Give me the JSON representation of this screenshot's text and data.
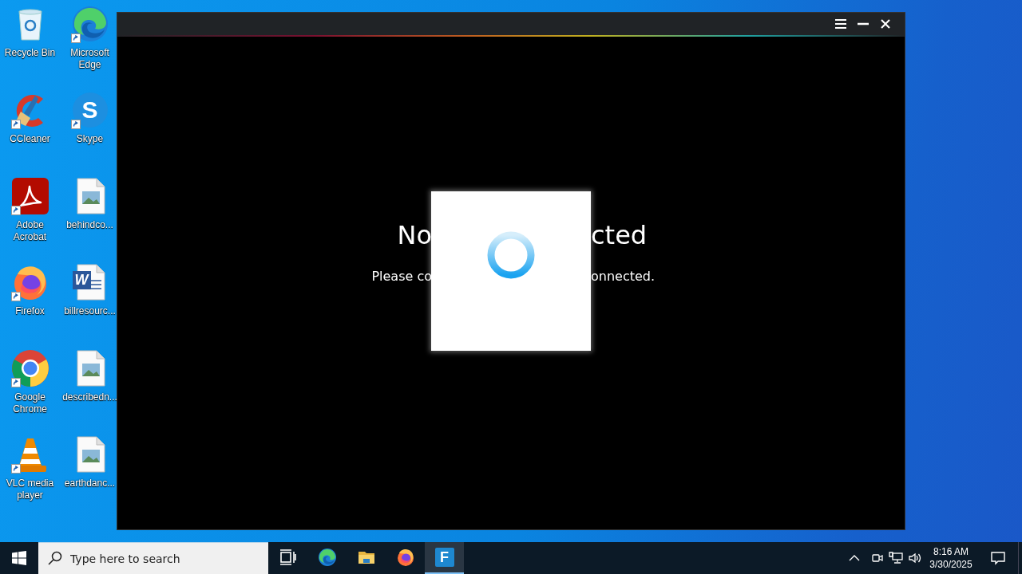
{
  "desktop_icons": [
    {
      "label": "Recycle Bin",
      "kind": "recycle",
      "shortcut": false
    },
    {
      "label": "CCleaner",
      "kind": "ccleaner",
      "shortcut": true
    },
    {
      "label": "Adobe Acrobat",
      "kind": "acrobat",
      "shortcut": true
    },
    {
      "label": "Firefox",
      "kind": "firefox",
      "shortcut": true
    },
    {
      "label": "Google Chrome",
      "kind": "chrome",
      "shortcut": true
    },
    {
      "label": "VLC media player",
      "kind": "vlc",
      "shortcut": true
    },
    {
      "label": "Microsoft Edge",
      "kind": "edge",
      "shortcut": true
    },
    {
      "label": "Skype",
      "kind": "skype",
      "glyph": "S",
      "shortcut": true
    },
    {
      "label": "behindco...",
      "kind": "image",
      "shortcut": false
    },
    {
      "label": "billresourc...",
      "kind": "word",
      "glyph": "W",
      "shortcut": false
    },
    {
      "label": "describedn...",
      "kind": "image",
      "shortcut": false
    },
    {
      "label": "earthdanc...",
      "kind": "image",
      "shortcut": false
    }
  ],
  "window": {
    "title_parts": [
      "No",
      "cted"
    ],
    "message_parts": [
      "Please co",
      "onnected."
    ],
    "dialog": {
      "kind": "loading"
    }
  },
  "taskbar": {
    "search": {
      "placeholder": "Type here to search"
    },
    "apps": [
      {
        "kind": "taskview",
        "selected": false
      },
      {
        "kind": "edge",
        "selected": false
      },
      {
        "kind": "explorer",
        "selected": false
      },
      {
        "kind": "firefox",
        "selected": false
      },
      {
        "kind": "app",
        "glyph": "F",
        "selected": true
      }
    ],
    "clock": {
      "time": "8:16 AM",
      "date": "3/30/2025"
    }
  }
}
